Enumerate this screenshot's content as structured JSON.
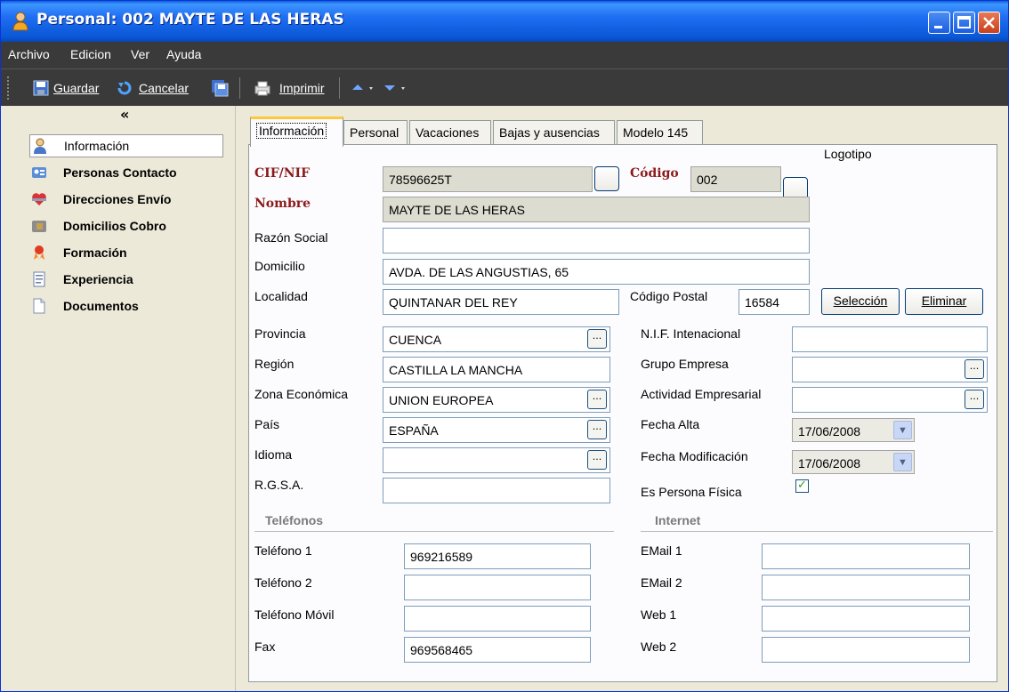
{
  "window": {
    "title": "Personal: 002 MAYTE DE LAS HERAS"
  },
  "menu": {
    "archivo": "Archivo",
    "edicion": "Edicion",
    "ver": "Ver",
    "ayuda": "Ayuda"
  },
  "toolbar": {
    "guardar": "Guardar",
    "cancelar": "Cancelar",
    "imprimir": "Imprimir"
  },
  "sidebar": {
    "collapse": "«",
    "items": [
      {
        "label": "Información",
        "icon": "person-icon"
      },
      {
        "label": "Personas Contacto",
        "icon": "contact-card-icon"
      },
      {
        "label": "Direcciones Envío",
        "icon": "heart-icon"
      },
      {
        "label": "Domicilios Cobro",
        "icon": "wallet-icon"
      },
      {
        "label": "Formación",
        "icon": "award-ribbon-icon"
      },
      {
        "label": "Experiencia",
        "icon": "document-icon"
      },
      {
        "label": "Documentos",
        "icon": "page-icon"
      }
    ]
  },
  "tabs": [
    "Información",
    "Personal",
    "Vacaciones",
    "Bajas y ausencias",
    "Modelo 145"
  ],
  "form": {
    "logo_label": "Logotipo",
    "cif_label": "CIF/NIF",
    "cif_value": "78596625T",
    "codigo_label": "Código",
    "codigo_value": "002",
    "nombre_label": "Nombre",
    "nombre_value": "MAYTE DE LAS HERAS",
    "razon_label": "Razón Social",
    "razon_value": "",
    "domicilio_label": "Domicilio",
    "domicilio_value": "AVDA. DE LAS ANGUSTIAS, 65",
    "localidad_label": "Localidad",
    "localidad_value": "QUINTANAR DEL REY",
    "cp_label": "Código Postal",
    "cp_value": "16584",
    "seleccion": "Selección",
    "eliminar": "Eliminar",
    "provincia_label": "Provincia",
    "provincia_value": "CUENCA",
    "region_label": "Región",
    "region_value": "CASTILLA LA MANCHA",
    "zona_label": "Zona Económica",
    "zona_value": "UNION EUROPEA",
    "pais_label": "País",
    "pais_value": "ESPAÑA",
    "idioma_label": "Idioma",
    "idioma_value": "",
    "rgsa_label": "R.G.S.A.",
    "rgsa_value": "",
    "nif_int_label": "N.I.F. Intenacional",
    "nif_int_value": "",
    "grupo_label": "Grupo Empresa",
    "grupo_value": "",
    "actividad_label": "Actividad Empresarial",
    "actividad_value": "",
    "fecha_alta_label": "Fecha Alta",
    "fecha_alta_value": "17/06/2008",
    "fecha_mod_label": "Fecha Modificación",
    "fecha_mod_value": "17/06/2008",
    "persona_fisica_label": "Es Persona Física",
    "persona_fisica_checked": true
  },
  "telefonos": {
    "title": "Teléfonos",
    "tel1_label": "Teléfono 1",
    "tel1_value": "969216589",
    "tel2_label": "Teléfono 2",
    "tel2_value": "",
    "movil_label": "Teléfono Móvil",
    "movil_value": "",
    "fax_label": "Fax",
    "fax_value": "969568465"
  },
  "internet": {
    "title": "Internet",
    "email1_label": "EMail 1",
    "email1_value": "",
    "email2_label": "EMail 2",
    "email2_value": "",
    "web1_label": "Web 1",
    "web1_value": "",
    "web2_label": "Web 2",
    "web2_value": ""
  },
  "colors": {
    "title_bar": "#0a58d6",
    "required_label": "#8b1a1a",
    "dark_bar": "#3a3a3a",
    "tab_highlight": "#ffc83c"
  }
}
